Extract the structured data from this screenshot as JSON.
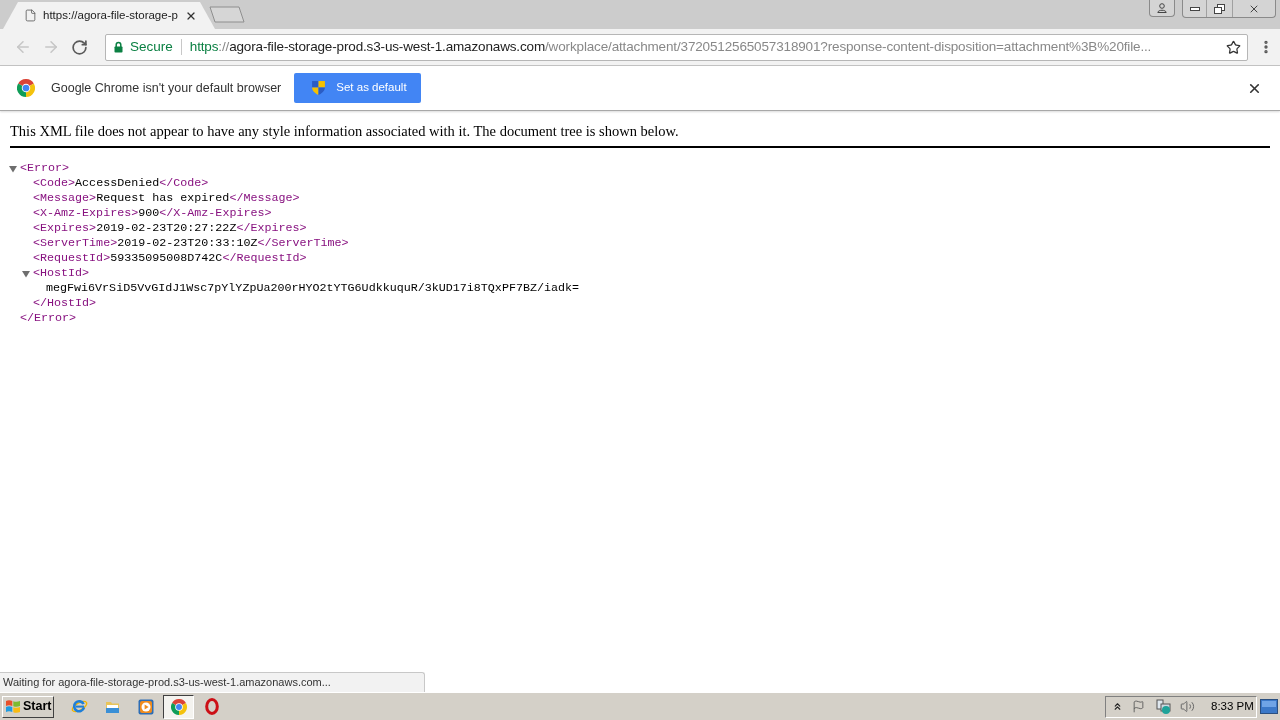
{
  "tabs": [
    {
      "title": "https://agora-file-storage-p",
      "selected": true
    }
  ],
  "toolbar": {
    "back_disabled": true,
    "forward_disabled": true,
    "security_label": "Secure",
    "url": {
      "scheme": "https",
      "separator": "://",
      "host": "agora-file-storage-prod.s3-us-west-1.amazonaws.com",
      "path": "/workplace/attachment/3720512565057318901?response-content-disposition=attachment%3B%20file..."
    }
  },
  "infobar": {
    "message": "Google Chrome isn't your default browser",
    "button": "Set as default"
  },
  "page": {
    "notice": "This XML file does not appear to have any style information associated with it. The document tree is shown below.",
    "tree": [
      {
        "kind": "parent",
        "open": "<Error>",
        "expanded": true,
        "close": "</Error>",
        "children": [
          {
            "kind": "leaf",
            "open": "<Code>",
            "text": "AccessDenied",
            "close": "</Code>"
          },
          {
            "kind": "leaf",
            "open": "<Message>",
            "text": "Request has expired",
            "close": "</Message>"
          },
          {
            "kind": "leaf",
            "open": "<X-Amz-Expires>",
            "text": "900",
            "close": "</X-Amz-Expires>"
          },
          {
            "kind": "leaf",
            "open": "<Expires>",
            "text": "2019-02-23T20:27:22Z",
            "close": "</Expires>"
          },
          {
            "kind": "leaf",
            "open": "<ServerTime>",
            "text": "2019-02-23T20:33:10Z",
            "close": "</ServerTime>"
          },
          {
            "kind": "leaf",
            "open": "<RequestId>",
            "text": "59335095008D742C",
            "close": "</RequestId>"
          },
          {
            "kind": "parent",
            "open": "<HostId>",
            "expanded": true,
            "close": "</HostId>",
            "children": [
              {
                "kind": "text",
                "text": "megFwi6VrSiD5VvGIdJ1Wsc7pYlYZpUa200rHYO2tYTG6UdkkuquR/3kUD17i8TQxPF7BZ/iadk="
              }
            ]
          }
        ]
      }
    ]
  },
  "status_bar": {
    "text": "Waiting for agora-file-storage-prod.s3-us-west-1.amazonaws.com..."
  },
  "taskbar": {
    "start": "Start",
    "apps": [
      {
        "kind": "ie",
        "selected": false
      },
      {
        "kind": "explorer",
        "selected": false
      },
      {
        "kind": "media",
        "selected": false
      },
      {
        "kind": "chrome",
        "selected": true
      },
      {
        "kind": "opera",
        "selected": false
      }
    ],
    "clock": "8:33 PM"
  }
}
